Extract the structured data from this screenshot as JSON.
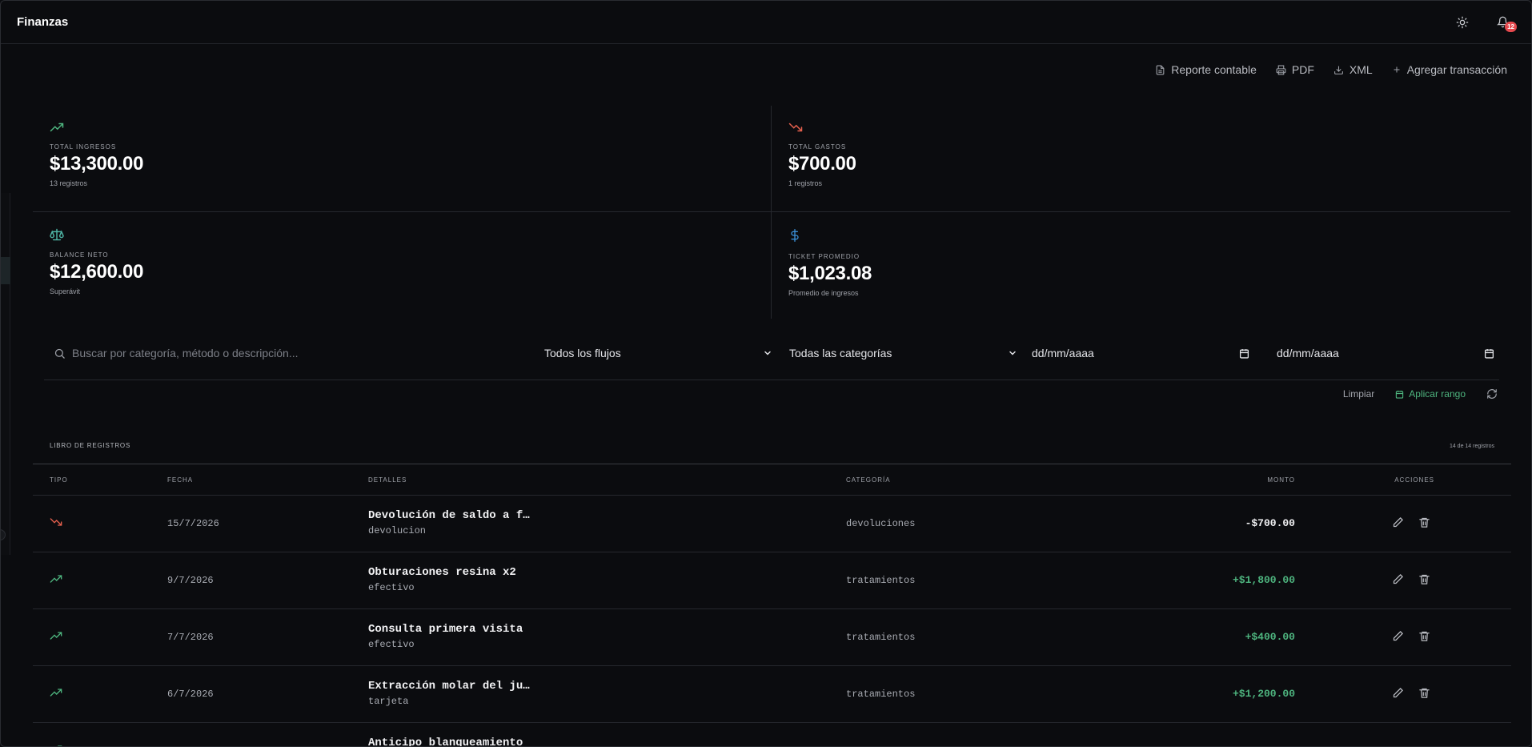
{
  "header": {
    "title": "Finanzas",
    "notifications_count": "12"
  },
  "toolbar": {
    "report_label": "Reporte contable",
    "pdf_label": "PDF",
    "xml_label": "XML",
    "add_label": "Agregar transacción"
  },
  "stats": [
    {
      "label": "TOTAL INGRESOS",
      "value": "$13,300.00",
      "sub": "13 registros",
      "icon": "trend-up-icon",
      "color": "#4eb57f"
    },
    {
      "label": "TOTAL GASTOS",
      "value": "$700.00",
      "sub": "1 registros",
      "icon": "trend-down-icon",
      "color": "#e5604d"
    },
    {
      "label": "BALANCE NETO",
      "value": "$12,600.00",
      "sub": "Superávit",
      "icon": "scale-icon",
      "color": "#4eb5a5"
    },
    {
      "label": "TICKET PROMEDIO",
      "value": "$1,023.08",
      "sub": "Promedio de ingresos",
      "icon": "dollar-icon",
      "color": "#3b8fd6"
    }
  ],
  "filters": {
    "search_placeholder": "Buscar por categoría, método o descripción...",
    "flow_select": "Todos los flujos",
    "category_select": "Todas las categorías",
    "date_from_placeholder": "dd/mm/aaaa",
    "date_to_placeholder": "dd/mm/aaaa",
    "clear_label": "Limpiar",
    "apply_label": "Aplicar rango"
  },
  "ledger": {
    "title": "LIBRO DE REGISTROS",
    "count": "14 de 14 registros",
    "columns": {
      "tipo": "TIPO",
      "fecha": "FECHA",
      "detalles": "DETALLES",
      "categoria": "CATEGORÍA",
      "monto": "MONTO",
      "acciones": "ACCIONES"
    },
    "rows": [
      {
        "type": "out",
        "date": "15/7/2026",
        "title": "Devolución de saldo a f…",
        "method": "devolucion",
        "category": "devoluciones",
        "amount": "-$700.00"
      },
      {
        "type": "in",
        "date": "9/7/2026",
        "title": "Obturaciones resina x2",
        "method": "efectivo",
        "category": "tratamientos",
        "amount": "+$1,800.00"
      },
      {
        "type": "in",
        "date": "7/7/2026",
        "title": "Consulta primera visita",
        "method": "efectivo",
        "category": "tratamientos",
        "amount": "+$400.00"
      },
      {
        "type": "in",
        "date": "6/7/2026",
        "title": "Extracción molar del ju…",
        "method": "tarjeta",
        "category": "tratamientos",
        "amount": "+$1,200.00"
      },
      {
        "type": "in",
        "date": "",
        "title": "Anticipo blanqueamiento",
        "method": "",
        "category": "",
        "amount": ""
      }
    ]
  },
  "colors": {
    "income": "#4eb57f",
    "expense": "#e5604d",
    "background": "#0b0c0f"
  }
}
